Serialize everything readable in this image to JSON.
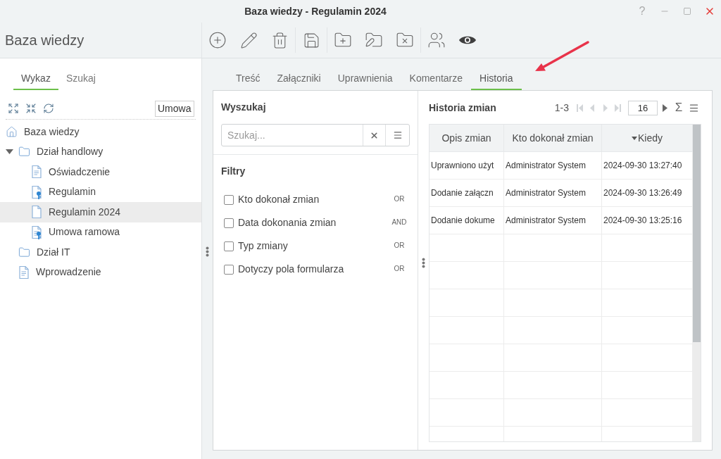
{
  "window": {
    "title": "Baza wiedzy - Regulamin 2024",
    "help_label": "?"
  },
  "app_title": "Baza wiedzy",
  "sidebar": {
    "tabs": [
      {
        "label": "Wykaz",
        "selected": true
      },
      {
        "label": "Szukaj",
        "selected": false
      }
    ],
    "filter_value": "Umowa",
    "tree": [
      {
        "label": "Baza wiedzy",
        "kind": "home",
        "selected": false,
        "children": [
          {
            "label": "Dział handlowy",
            "kind": "folder",
            "expanded": true,
            "selected": false,
            "children": [
              {
                "label": "Oświadczenie",
                "kind": "text-file",
                "selected": false
              },
              {
                "label": "Regulamin",
                "kind": "key-file",
                "selected": false
              },
              {
                "label": "Regulamin 2024",
                "kind": "blank-file",
                "selected": true
              },
              {
                "label": "Umowa ramowa",
                "kind": "key-text-file",
                "selected": false
              }
            ]
          },
          {
            "label": "Dział IT",
            "kind": "folder",
            "selected": false
          },
          {
            "label": "Wprowadzenie",
            "kind": "text-file",
            "selected": false
          }
        ]
      }
    ]
  },
  "content_tabs": [
    {
      "label": "Treść",
      "selected": false
    },
    {
      "label": "Załączniki",
      "selected": false
    },
    {
      "label": "Uprawnienia",
      "selected": false
    },
    {
      "label": "Komentarze",
      "selected": false
    },
    {
      "label": "Historia",
      "selected": true
    }
  ],
  "search_panel": {
    "title": "Wyszukaj",
    "search": {
      "placeholder": "Szukaj..."
    },
    "filters_title": "Filtry",
    "filters": [
      {
        "label": "Kto dokonał zmian",
        "checked": false,
        "operator": "OR"
      },
      {
        "label": "Data dokonania zmian",
        "checked": false,
        "operator": "AND"
      },
      {
        "label": "Typ zmiany",
        "checked": false,
        "operator": "OR"
      },
      {
        "label": "Dotyczy pola formularza",
        "checked": false,
        "operator": "OR"
      }
    ]
  },
  "history": {
    "title": "Historia zmian",
    "range": "1-3",
    "pager": [
      {
        "kind": "first",
        "disabled": true
      },
      {
        "kind": "prev",
        "disabled": true
      },
      {
        "kind": "next",
        "disabled": true
      },
      {
        "kind": "last",
        "disabled": true
      }
    ],
    "page_size": "16",
    "sum_label": "Σ",
    "table": {
      "columns": [
        {
          "label": "Opis zmian",
          "sorted": false
        },
        {
          "label": "Kto dokonał zmian",
          "sorted": false
        },
        {
          "label": "Kiedy",
          "sorted": true
        }
      ],
      "rows": [
        [
          "Uprawniono użyt",
          "Administrator System",
          "2024-09-30 13:27:40"
        ],
        [
          "Dodanie załączn",
          "Administrator System",
          "2024-09-30 13:26:49"
        ],
        [
          "Dodanie dokume",
          "Administrator System",
          "2024-09-30 13:25:16"
        ]
      ]
    }
  }
}
